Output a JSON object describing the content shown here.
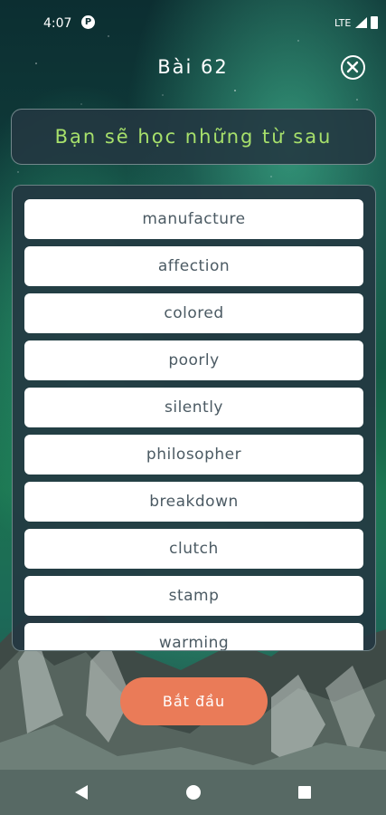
{
  "status_bar": {
    "time": "4:07",
    "notification_glyph": "P",
    "network": "LTE"
  },
  "header": {
    "title": "Bài 62"
  },
  "intro": {
    "text": "Bạn sẽ học những từ sau"
  },
  "words": [
    "manufacture",
    "affection",
    "colored",
    "poorly",
    "silently",
    "philosopher",
    "breakdown",
    "clutch",
    "stamp",
    "warming"
  ],
  "actions": {
    "start_label": "Bắt đầu"
  },
  "colors": {
    "accent_green": "#a7e06b",
    "start_button": "#ea7b58",
    "word_text": "#4b5a63"
  }
}
